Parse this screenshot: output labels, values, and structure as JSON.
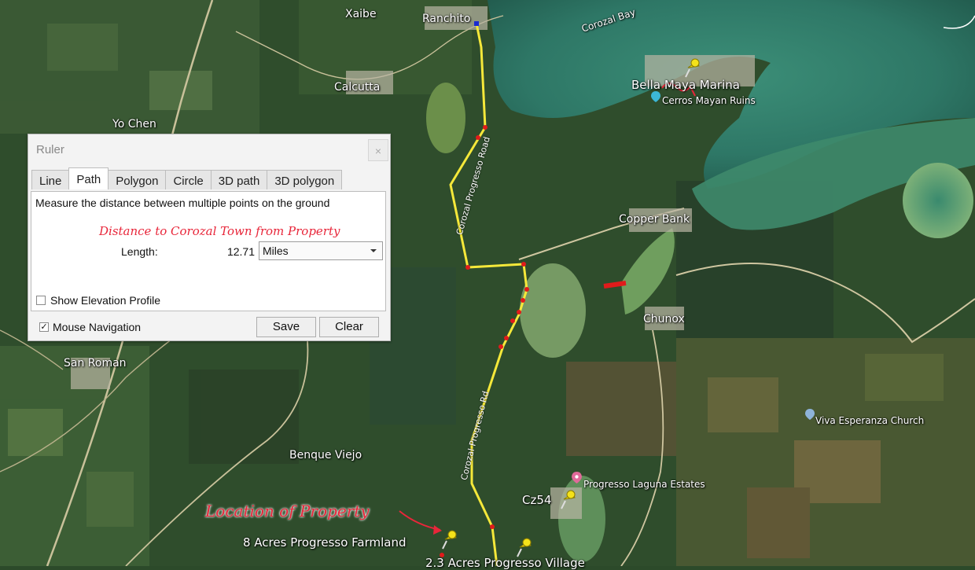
{
  "map": {
    "places": {
      "xaibe": "Xaibe",
      "ranchito": "Ranchito",
      "calcutta": "Calcutta",
      "yo_chen": "Yo Chen",
      "corozal_bay": "Corozal Bay",
      "bella_maya": "Bella Maya Marina",
      "cerros": "Cerros Mayan Ruins",
      "copper_bank": "Copper Bank",
      "chunox": "Chunox",
      "san_roman": "San Roman",
      "viva_esperanza": "Viva Esperanza Church",
      "benque_viejo": "Benque Viejo",
      "progresso_laguna": "Progresso Laguna Estates",
      "cz54": "Cz54",
      "farmland": "8 Acres Progresso Farmland",
      "village": "2.3 Acres Progresso Village"
    },
    "roads": {
      "upper": "Corozal Progresso Road",
      "lower": "Corozal Progresso Rd"
    },
    "annotation": "Location of Property",
    "colors": {
      "path": "#f5e83a",
      "path_vertex": "#e01b1b",
      "annotation": "#e8263a"
    }
  },
  "ruler": {
    "title": "Ruler",
    "close_label": "×",
    "tabs": [
      {
        "label": "Line",
        "active": false
      },
      {
        "label": "Path",
        "active": true
      },
      {
        "label": "Polygon",
        "active": false
      },
      {
        "label": "Circle",
        "active": false
      },
      {
        "label": "3D path",
        "active": false
      },
      {
        "label": "3D polygon",
        "active": false
      }
    ],
    "description": "Measure the distance between multiple points on the ground",
    "overlay_text": "Distance to Corozal Town from Property",
    "length_label": "Length:",
    "length_value": "12.71",
    "unit": "Miles",
    "show_elevation_label": "Show Elevation Profile",
    "show_elevation_checked": false,
    "mouse_nav_label": "Mouse Navigation",
    "mouse_nav_checked": true,
    "save_label": "Save",
    "clear_label": "Clear"
  }
}
